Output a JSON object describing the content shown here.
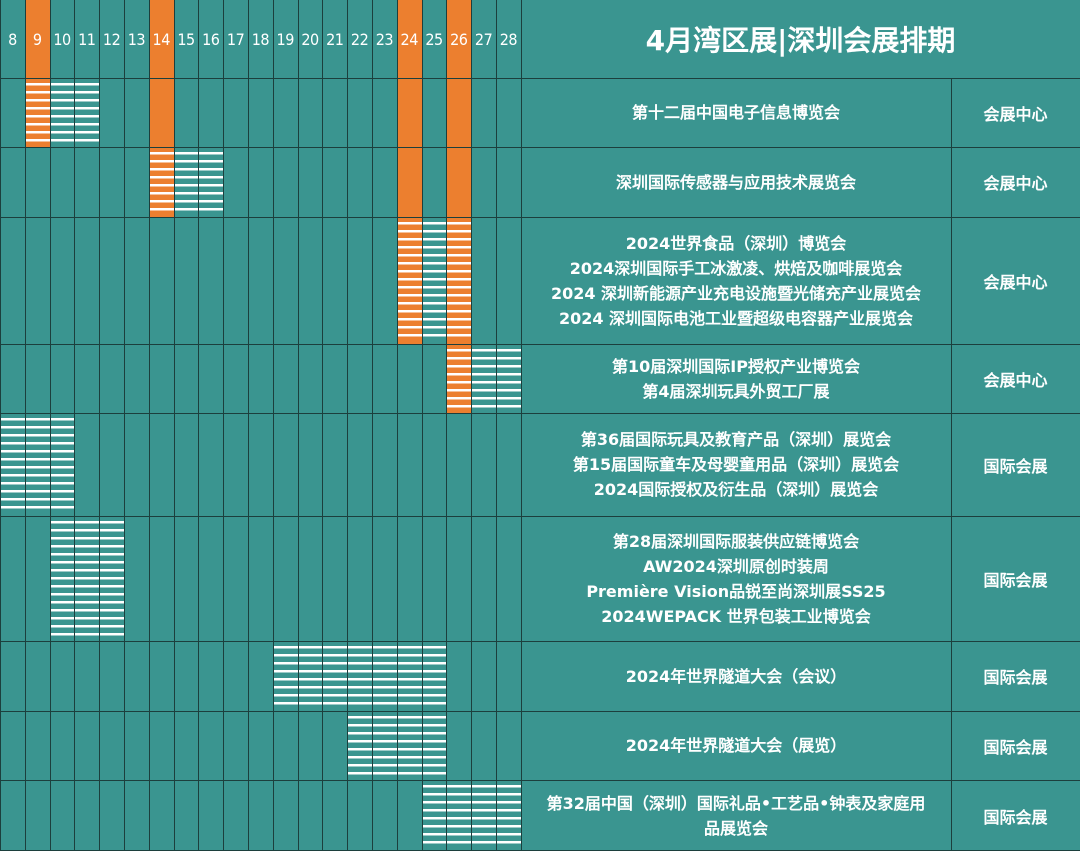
{
  "title": "4月湾区展|深圳会展排期",
  "days": [
    "8",
    "9",
    "10",
    "11",
    "12",
    "13",
    "14",
    "15",
    "16",
    "17",
    "18",
    "19",
    "20",
    "21",
    "22",
    "23",
    "24",
    "25",
    "26",
    "27",
    "28"
  ],
  "highlight_days": [
    "9",
    "14",
    "24",
    "26"
  ],
  "colors": {
    "background": "#3a9590",
    "highlight": "#ec7f2f",
    "stripes": "#ffffff",
    "grid": "#1c3f3d"
  },
  "rows": [
    {
      "events": [
        "第十二届中国电子信息博览会"
      ],
      "venue": "会展中心",
      "span": [
        "9",
        "11"
      ]
    },
    {
      "events": [
        "深圳国际传感器与应用技术展览会"
      ],
      "venue": "会展中心",
      "span": [
        "14",
        "16"
      ]
    },
    {
      "events": [
        "2024世界食品（深圳）博览会",
        "2024深圳国际手工冰激凌、烘焙及咖啡展览会",
        "2024 深圳新能源产业充电设施暨光储充产业展览会",
        "2024 深圳国际电池工业暨超级电容器产业展览会"
      ],
      "venue": "会展中心",
      "span": [
        "24",
        "26"
      ]
    },
    {
      "events": [
        "第10届深圳国际IP授权产业博览会",
        "第4届深圳玩具外贸工厂展"
      ],
      "venue": "会展中心",
      "span": [
        "26",
        "28"
      ]
    },
    {
      "events": [
        "第36届国际玩具及教育产品（深圳）展览会",
        "第15届国际童车及母婴童用品（深圳）展览会",
        "2024国际授权及衍生品（深圳）展览会"
      ],
      "venue": "国际会展",
      "span": [
        "8",
        "10"
      ]
    },
    {
      "events": [
        "第28届深圳国际服装供应链博览会",
        "AW2024深圳原创时装周",
        "Première Vision品锐至尚深圳展SS25",
        "2024WEPACK 世界包装工业博览会"
      ],
      "venue": "国际会展",
      "span": [
        "10",
        "12"
      ]
    },
    {
      "events": [
        "2024年世界隧道大会（会议）"
      ],
      "venue": "国际会展",
      "span": [
        "19",
        "25"
      ]
    },
    {
      "events": [
        "2024年世界隧道大会（展览）"
      ],
      "venue": "国际会展",
      "span": [
        "22",
        "25"
      ]
    },
    {
      "events": [
        "第32届中国（深圳）国际礼品•工艺品•钟表及家庭用",
        "品展览会"
      ],
      "venue": "国际会展",
      "span": [
        "25",
        "28"
      ]
    }
  ]
}
